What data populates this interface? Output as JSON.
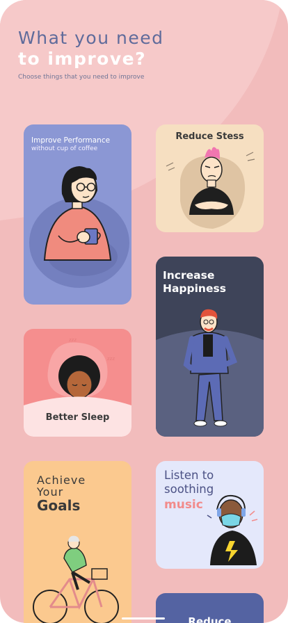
{
  "header": {
    "title_line1": "What you need",
    "title_line2": "to improve?",
    "subtitle": "Choose things that you need to improve"
  },
  "cards": {
    "performance": {
      "title": "Improve Performance",
      "subtitle": "without cup of coffee",
      "color": "#8b97d4"
    },
    "stress": {
      "title": "Reduce Stess",
      "color": "#f6dfc1"
    },
    "happiness": {
      "title_line1": "Increase",
      "title_line2": "Happiness",
      "color": "#3e4459"
    },
    "sleep": {
      "title": "Better Sleep",
      "color": "#f58e8e"
    },
    "goals": {
      "line1": "Achieve",
      "line2": "Your",
      "line3": "Goals",
      "color": "#fbc98f"
    },
    "music": {
      "line1": "Listen to",
      "line2": "soothing",
      "line3": "music",
      "accent": "#f28b8b",
      "color": "#e4e8fb"
    },
    "reduce": {
      "title": "Reduce",
      "color": "#5463a2"
    }
  },
  "colors": {
    "background": "#f2bcbc",
    "title_primary": "#5f6b9b",
    "title_secondary": "#ffffff"
  }
}
